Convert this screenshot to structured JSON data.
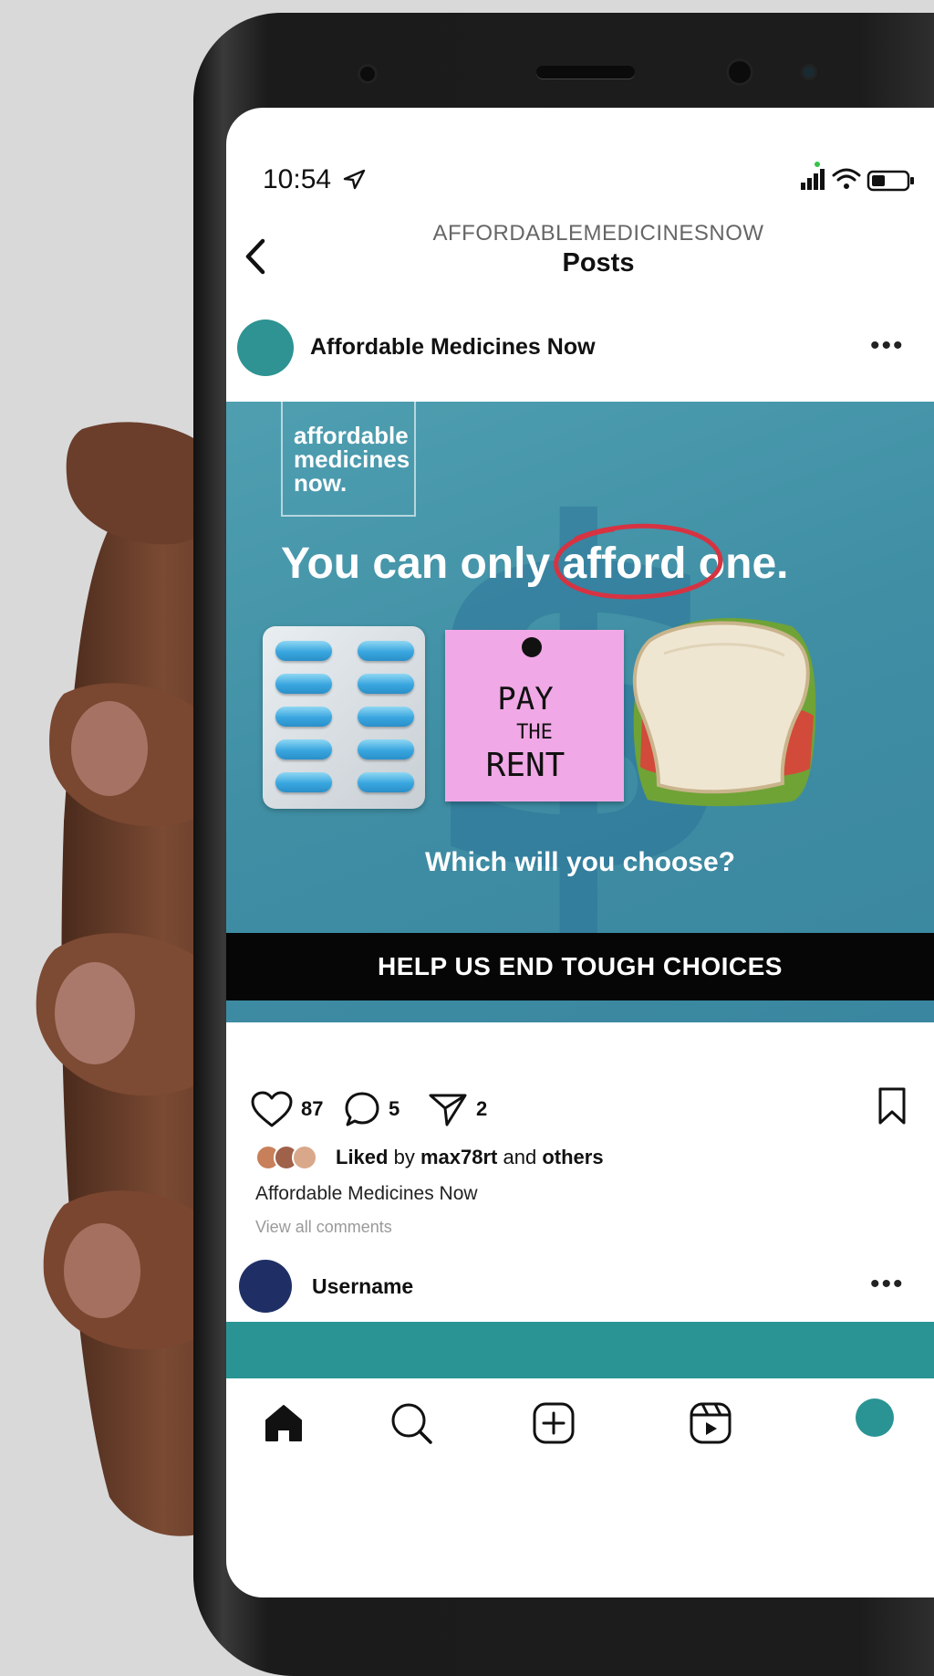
{
  "status_bar": {
    "time": "10:54"
  },
  "header": {
    "account": "AFFORDABLEMEDICINESNOW",
    "title": "Posts"
  },
  "post": {
    "author": "Affordable Medicines Now",
    "image": {
      "brand_lines": [
        "affordable",
        "medicines",
        "now."
      ],
      "headline_pre": "You can only ",
      "headline_emph": "afford",
      "headline_post": " one.",
      "note_lines": [
        "PAY",
        "THE",
        "RENT"
      ],
      "subhead": "Which will you choose?"
    },
    "cta": "HELP US END TOUGH CHOICES",
    "likes": "87",
    "comments": "5",
    "shares": "2",
    "liked_by_prefix": "Liked",
    "liked_by_mid": "by",
    "liked_by_user": "max78rt",
    "liked_by_and": "and",
    "liked_by_others": "others",
    "caption": "Affordable Medicines Now",
    "view_comments": "View all comments"
  },
  "comment": {
    "username": "Username"
  },
  "colors": {
    "brand_teal": "#2e9392",
    "post_blue": "#4a9bb0",
    "sticky_pink": "#f1a8e6",
    "pill_blue": "#39a6df",
    "comment_avatar": "#1f2f66"
  },
  "icons": {
    "nav": [
      "home-icon",
      "search-icon",
      "create-icon",
      "reels-icon",
      "profile-avatar"
    ],
    "actions": [
      "heart-icon",
      "comment-icon",
      "share-icon",
      "bookmark-icon"
    ]
  }
}
